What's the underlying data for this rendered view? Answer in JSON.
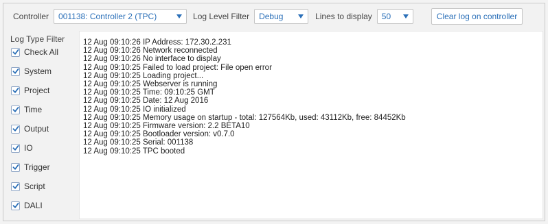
{
  "toolbar": {
    "controller_label": "Controller",
    "controller_value": "001138: Controller 2 (TPC)",
    "log_level_label": "Log Level Filter",
    "log_level_value": "Debug",
    "lines_label": "Lines to display",
    "lines_value": "50",
    "clear_button": "Clear log on controller"
  },
  "sidebar": {
    "title": "Log Type Filter",
    "items": [
      {
        "label": "Check All",
        "checked": true
      },
      {
        "label": "System",
        "checked": true
      },
      {
        "label": "Project",
        "checked": true
      },
      {
        "label": "Time",
        "checked": true
      },
      {
        "label": "Output",
        "checked": true
      },
      {
        "label": "IO",
        "checked": true
      },
      {
        "label": "Trigger",
        "checked": true
      },
      {
        "label": "Script",
        "checked": true
      },
      {
        "label": "DALI",
        "checked": true
      }
    ]
  },
  "log": {
    "lines": [
      "12 Aug 09:10:26 IP Address: 172.30.2.231",
      "12 Aug 09:10:26 Network reconnected",
      "12 Aug 09:10:26 No interface to display",
      "12 Aug 09:10:25 Failed to load project: File open error",
      "12 Aug 09:10:25 Loading project...",
      "12 Aug 09:10:25 Webserver is running",
      "12 Aug 09:10:25 Time: 09:10:25 GMT",
      "12 Aug 09:10:25 Date: 12 Aug 2016",
      "12 Aug 09:10:25 IO initialized",
      "12 Aug 09:10:25 Memory usage on startup - total: 127564Kb, used: 43112Kb, free: 84452Kb",
      "12 Aug 09:10:25 Firmware version: 2.2 BETA10",
      "12 Aug 09:10:25 Bootloader version: v0.7.0",
      "12 Aug 09:10:25 Serial: 001138",
      "12 Aug 09:10:25 TPC booted"
    ]
  },
  "colors": {
    "accent": "#2a6fb8",
    "checkmark": "#2a6fb8"
  }
}
